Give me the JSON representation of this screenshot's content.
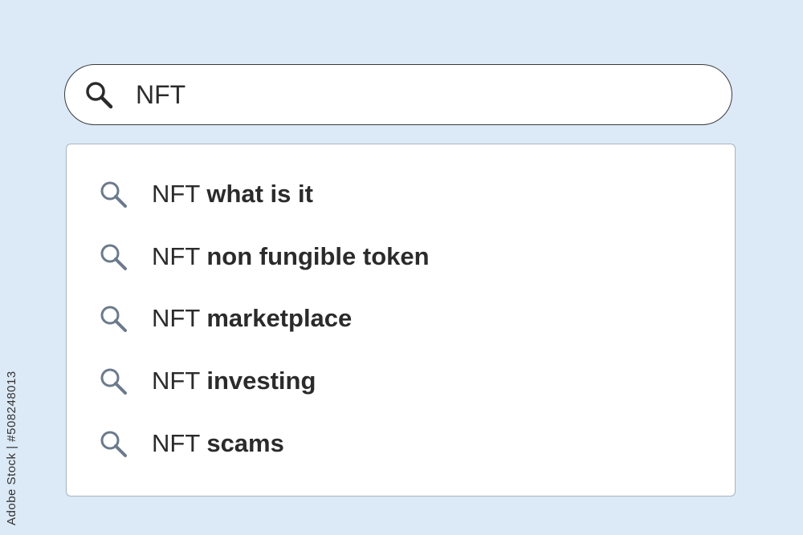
{
  "search": {
    "value": "NFT",
    "icon": "search-icon"
  },
  "suggestions": [
    {
      "prefix": "NFT",
      "completion": "what is it"
    },
    {
      "prefix": "NFT",
      "completion": "non fungible token"
    },
    {
      "prefix": "NFT",
      "completion": "marketplace"
    },
    {
      "prefix": "NFT",
      "completion": "investing"
    },
    {
      "prefix": "NFT",
      "completion": "scams"
    }
  ],
  "watermark": "Adobe Stock | #508248013",
  "colors": {
    "background": "#dce9f7",
    "text": "#2b2b2b",
    "suggestion_icon": "#6b7a8c",
    "search_icon": "#2b2b2b"
  }
}
